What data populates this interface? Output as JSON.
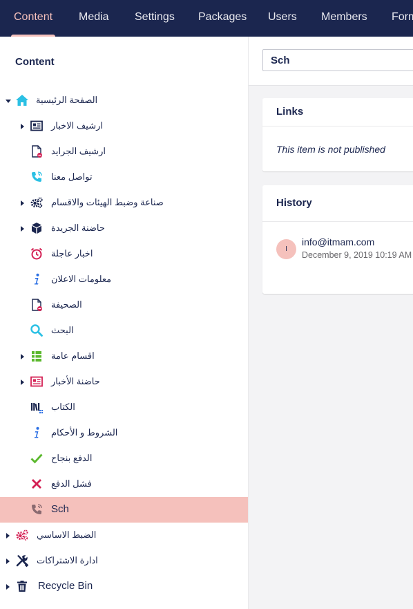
{
  "nav": {
    "tabs": [
      {
        "label": "Content",
        "active": true
      },
      {
        "label": "Media"
      },
      {
        "label": "Settings"
      },
      {
        "label": "Packages"
      },
      {
        "label": "Users"
      },
      {
        "label": "Members"
      },
      {
        "label": "Forms"
      }
    ]
  },
  "tree": {
    "title": "Content",
    "nodes": [
      {
        "label": "الصفحة الرئيسية",
        "icon": "home-icon",
        "expanded": true
      },
      {
        "label": "ارشيف الاخبار",
        "icon": "newspaper-icon",
        "has_children": true
      },
      {
        "label": "ارشيف الجرايد",
        "icon": "unpublished-document-icon"
      },
      {
        "label": "تواصل معنا",
        "icon": "phone-icon"
      },
      {
        "label": "صناعة وضبط الهيئات والاقسام",
        "icon": "settings-gears-icon",
        "has_children": true
      },
      {
        "label": "حاضنة الجريدة",
        "icon": "box-icon",
        "has_children": true
      },
      {
        "label": "اخبار عاجلة",
        "icon": "alarm-clock-icon"
      },
      {
        "label": "معلومات الاعلان",
        "icon": "info-icon"
      },
      {
        "label": "الصحيفة",
        "icon": "unpublished-document-icon"
      },
      {
        "label": "البحث",
        "icon": "search-icon"
      },
      {
        "label": "اقسام عامة",
        "icon": "grid-list-icon",
        "has_children": true
      },
      {
        "label": "حاضنة الأخبار",
        "icon": "newspaper-red-icon",
        "has_children": true
      },
      {
        "label": "الكتاب",
        "icon": "books-icon"
      },
      {
        "label": "الشروط و الأحكام",
        "icon": "info-icon"
      },
      {
        "label": "الدفع بنجاح",
        "icon": "checkmark-icon"
      },
      {
        "label": "فشل الدفع",
        "icon": "cross-icon"
      },
      {
        "label": "Sch",
        "icon": "phone-icon",
        "selected": true
      },
      {
        "label": "الضبط الاساسي",
        "icon": "settings-gears-red-icon",
        "has_children": true
      },
      {
        "label": "ادارة الاشتراكات",
        "icon": "tools-icon",
        "has_children": true
      },
      {
        "label": "Recycle Bin",
        "icon": "trash-icon",
        "has_children": true
      }
    ]
  },
  "editor": {
    "name_value": "Sch",
    "links": {
      "title": "Links",
      "status_text": "This item is not published"
    },
    "history": {
      "title": "History",
      "avatar_initial": "I",
      "entry_user": "info@itmam.com",
      "entry_date": "December 9, 2019 10:19 AM"
    }
  },
  "colors": {
    "nav_bg": "#1b264f",
    "accent": "#f5c1bc",
    "text": "#1b264f",
    "icon_blue": "#2bc0e4",
    "icon_red": "#d42054",
    "icon_green": "#5ab82c",
    "icon_dark": "#1b264f"
  }
}
